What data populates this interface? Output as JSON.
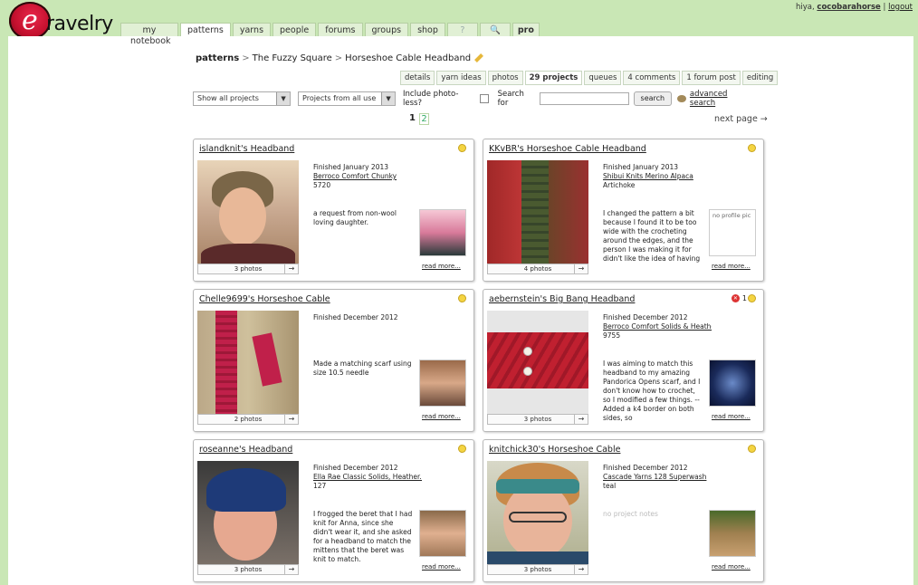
{
  "header": {
    "logo_text": "ravelry",
    "nav": [
      {
        "label": "my"
      },
      {
        "label": "patterns"
      },
      {
        "label": "yarns"
      },
      {
        "label": "people"
      },
      {
        "label": "forums"
      },
      {
        "label": "groups"
      },
      {
        "label": "shop"
      },
      {
        "label": "?"
      },
      {
        "label": "🔍"
      },
      {
        "label": "pro"
      }
    ],
    "notebook_label": "notebook",
    "greeting": "hiya,",
    "username": "cocobarahorse",
    "logout": "logout"
  },
  "breadcrumb": {
    "section": "patterns",
    "parent": "The Fuzzy Square",
    "current": "Horseshoe Cable Headband"
  },
  "subtabs": [
    "details",
    "yarn ideas",
    "photos",
    "29 projects",
    "queues",
    "4 comments",
    "1 forum post",
    "editing"
  ],
  "filters": {
    "show": "Show all projects",
    "from": "Projects from all use",
    "photoless_label": "Include photo-less?",
    "search_label": "Search for",
    "search_button": "search",
    "advanced": "advanced search"
  },
  "pager": {
    "current": "1",
    "next_num": "2",
    "next_page": "next page →"
  },
  "projects": [
    {
      "title": "islandknit's Headband",
      "status": "Finished January 2013",
      "yarn": "Berroco Comfort Chunky",
      "color": "5720",
      "notes": "a request from non-wool loving daughter.",
      "photos": "3 photos",
      "read_more": "read more..."
    },
    {
      "title": "KKvBR's Horseshoe Cable Headband",
      "status": "Finished January 2013",
      "yarn": "Shibui Knits Merino Alpaca",
      "color": "Artichoke",
      "notes": "I changed the pattern a bit because I found it to be too wide with the crocheting around the edges, and the person I was making it for didn't like the idea of having",
      "avatar_text": "no profile pic",
      "photos": "4 photos",
      "read_more": "read more..."
    },
    {
      "title": "Chelle9699's Horseshoe Cable",
      "status": "Finished December 2012",
      "yarn": "",
      "color": "",
      "notes": "Made a matching scarf using size 10.5 needle",
      "photos": "2 photos",
      "read_more": "read more..."
    },
    {
      "title": "aebernstein's Big Bang Headband",
      "status": "Finished December 2012",
      "yarn": "Berroco Comfort Solids & Heathers",
      "color": "9755",
      "notes": "I was aiming to match this headband to my amazing Pandorica Opens scarf, and I don't know how to crochet, so I modified a few things. --Added a k4 border on both sides, so",
      "badge_count": "1",
      "photos": "3 photos",
      "read_more": "read more..."
    },
    {
      "title": "roseanne's Headband",
      "status": "Finished December 2012",
      "yarn": "Ella Rae Classic Solids, Heather...",
      "color": "127",
      "notes": "I frogged the beret that I had knit for Anna, since she didn't wear it, and she asked for a headband to match the mittens that the beret was knit to match.",
      "photos": "3 photos",
      "read_more": "read more..."
    },
    {
      "title": "knitchick30's Horseshoe Cable",
      "status": "Finished December 2012",
      "yarn": "Cascade Yarns 128 Superwash",
      "color": "teal",
      "notes": "no project notes",
      "photos": "3 photos",
      "read_more": "read more..."
    }
  ],
  "colors": {
    "page_bg": "#c9e7b5",
    "nav_tab_bg": "#e1f0d5",
    "smiley": "#f4d442"
  }
}
